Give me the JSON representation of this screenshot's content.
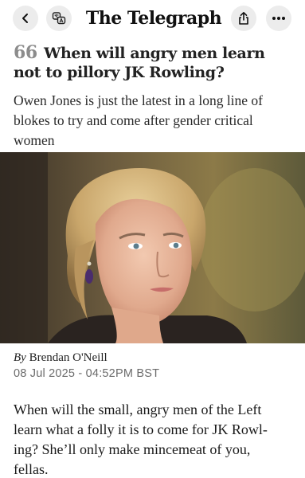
{
  "app": {
    "masthead": "The Telegraph"
  },
  "toolbar": {
    "back": "back-icon",
    "translate": "translate-icon",
    "share": "share-icon",
    "more": "more-icon"
  },
  "article": {
    "quote_glyph": "66",
    "headline": "When will angry men learn not to pillory JK Rowling?",
    "standfirst": "Owen Jones is just the latest in a long line of blokes to try and come after gender critical women",
    "byline_prefix": "By",
    "author": "Brendan O'Neill",
    "date": "08 Jul 2025 - 04:52PM BST",
    "body_line1": "When will the small, angry men of the Left",
    "body_line2": "learn what a folly it is to come for JK Rowl-",
    "body_line3": "ing? She’ll only make mincemeat of you,",
    "body_line4": "fellas."
  },
  "colors": {
    "button_bg": "#ececec",
    "quote_grey": "#8c8c8c",
    "date_grey": "#6b6b6b"
  }
}
